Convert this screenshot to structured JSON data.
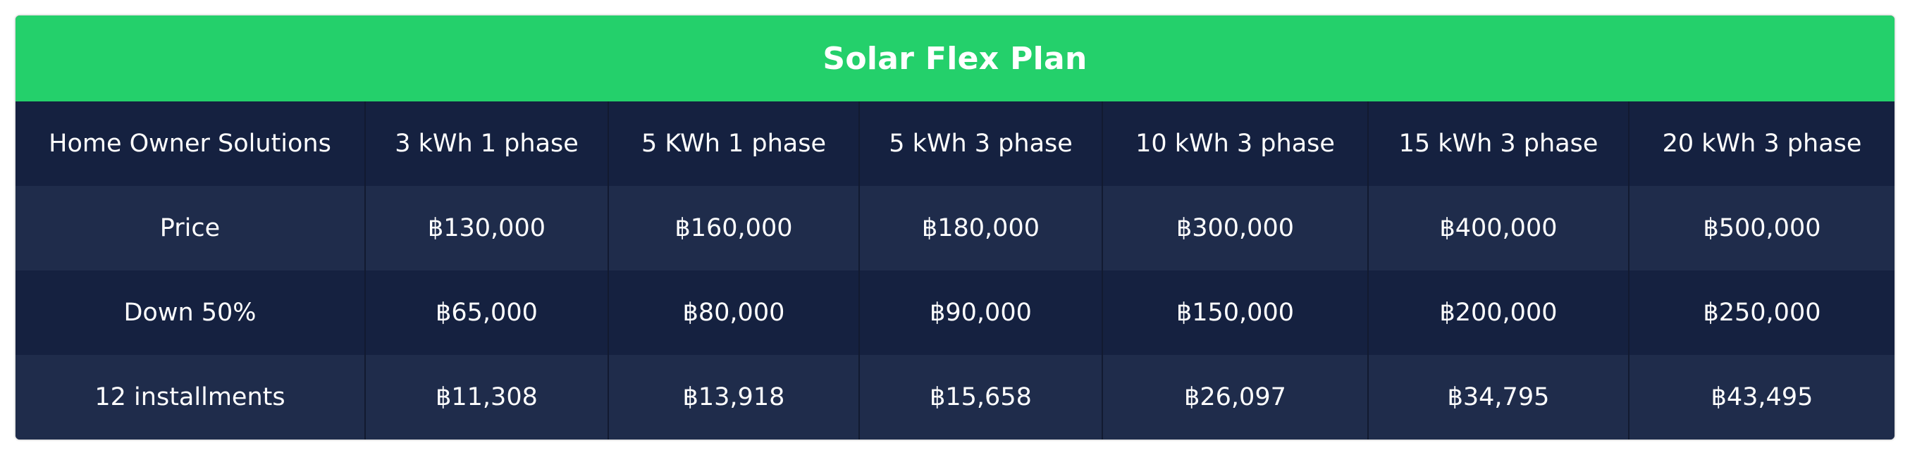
{
  "title": "Solar Flex Plan",
  "columns": [
    "Home Owner Solutions",
    "3 kWh 1 phase",
    "5 KWh 1 phase",
    "5 kWh 3 phase",
    "10 kWh 3 phase",
    "15 kWh 3 phase",
    "20 kWh 3 phase"
  ],
  "rows": [
    {
      "label": "Price",
      "values": [
        "฿130,000",
        "฿160,000",
        "฿180,000",
        "฿300,000",
        "฿400,000",
        "฿500,000"
      ]
    },
    {
      "label": "Down 50%",
      "values": [
        "฿65,000",
        "฿80,000",
        "฿90,000",
        "฿150,000",
        "฿200,000",
        "฿250,000"
      ]
    },
    {
      "label": "12 installments",
      "values": [
        "฿11,308",
        "฿13,918",
        "฿15,658",
        "฿26,097",
        "฿34,795",
        "฿43,495"
      ]
    }
  ],
  "colors": {
    "title_bg": "#24d06b",
    "header_bg": "#152140",
    "row_bg": "#1f2c4b",
    "row_alt_bg": "#152140",
    "text": "#ffffff"
  }
}
